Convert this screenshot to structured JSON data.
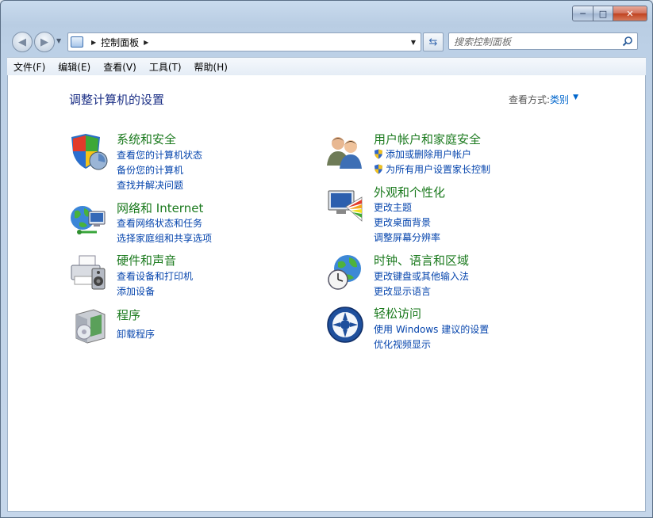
{
  "address": {
    "crumb": "控制面板"
  },
  "search": {
    "placeholder": "搜索控制面板"
  },
  "menu": [
    "文件(F)",
    "编辑(E)",
    "查看(V)",
    "工具(T)",
    "帮助(H)"
  ],
  "main": {
    "heading": "调整计算机的设置",
    "view_by_label": "查看方式:",
    "view_by_value": "类别"
  },
  "categories": [
    {
      "title": "系统和安全",
      "links": [
        "查看您的计算机状态",
        "备份您的计算机",
        "查找并解决问题"
      ]
    },
    {
      "title": "网络和 Internet",
      "links": [
        "查看网络状态和任务",
        "选择家庭组和共享选项"
      ]
    },
    {
      "title": "硬件和声音",
      "links": [
        "查看设备和打印机",
        "添加设备"
      ]
    },
    {
      "title": "程序",
      "links": [
        "卸载程序"
      ]
    },
    {
      "title": "用户帐户和家庭安全",
      "links": [
        "添加或删除用户帐户",
        "为所有用户设置家长控制"
      ]
    },
    {
      "title": "外观和个性化",
      "links": [
        "更改主题",
        "更改桌面背景",
        "调整屏幕分辨率"
      ]
    },
    {
      "title": "时钟、语言和区域",
      "links": [
        "更改键盘或其他输入法",
        "更改显示语言"
      ]
    },
    {
      "title": "轻松访问",
      "links": [
        "使用 Windows 建议的设置",
        "优化视频显示"
      ]
    }
  ],
  "colors": {
    "category_title": "#1b7a1e",
    "link": "#0645ad",
    "heading": "#1e3287"
  }
}
